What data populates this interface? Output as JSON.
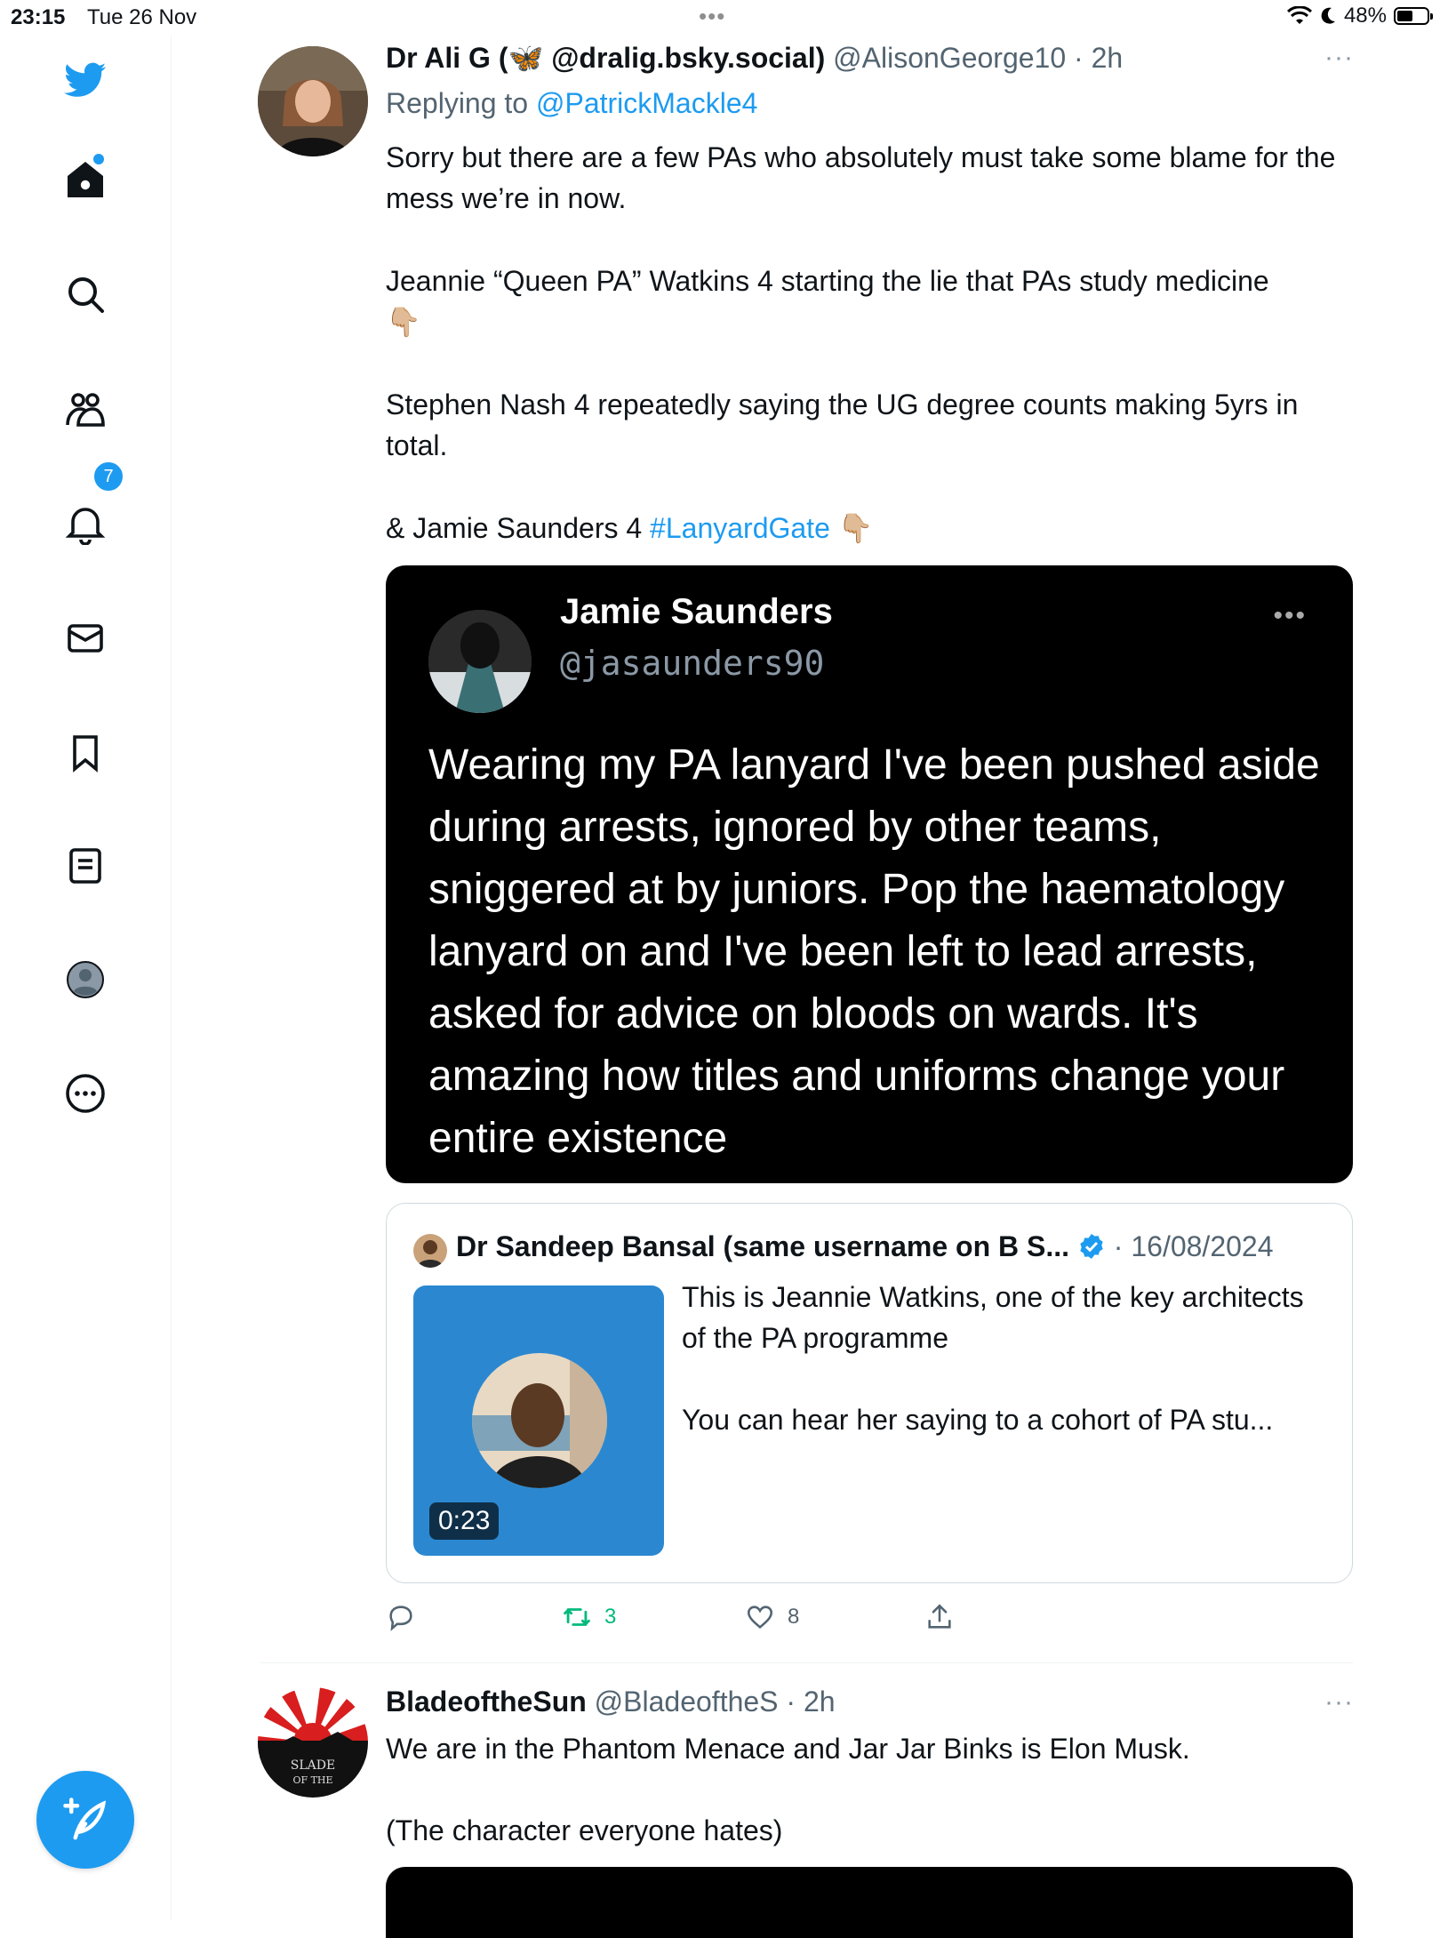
{
  "status_bar": {
    "time": "23:15",
    "date": "Tue 26 Nov",
    "dots": "•••",
    "battery": "48%",
    "battery_level": 0.48
  },
  "sidebar": {
    "items": [
      {
        "name": "twitter-logo-icon"
      },
      {
        "name": "home-icon"
      },
      {
        "name": "search-icon"
      },
      {
        "name": "communities-icon"
      },
      {
        "name": "notifications-icon",
        "badge": "7"
      },
      {
        "name": "messages-icon"
      },
      {
        "name": "bookmarks-icon"
      },
      {
        "name": "lists-icon"
      },
      {
        "name": "profile-icon"
      },
      {
        "name": "more-icon"
      }
    ],
    "compose_icon": "compose-icon"
  },
  "tweet1": {
    "name": "Dr Ali G (🦋 @dralig.bsky.social)",
    "handle": "@AlisonGeorge10",
    "sep": "·",
    "time": "2h",
    "more": "···",
    "replying_prefix": "Replying to",
    "replying_to": "@PatrickMackle4",
    "p1": "Sorry but there are a few PAs who absolutely must take some blame for the mess we’re in now.",
    "p2": "Jeannie “Queen PA” Watkins 4 starting the lie that PAs study medicine",
    "p2_emoji": "👇🏼",
    "p3": "Stephen Nash 4 repeatedly saying the UG degree counts making 5yrs in total.",
    "p4_prefix": "& Jamie Saunders 4",
    "p4_hashtag": "#LanyardGate",
    "p4_emoji": "👇🏼",
    "embedded_image": {
      "name": "Jamie Saunders",
      "handle": "@jasaunders90",
      "more": "•••",
      "text": "Wearing my PA lanyard I've been pushed aside during arrests, ignored by other teams, sniggered at by juniors. Pop the haematology lanyard on and I've been left to lead arrests, asked for advice on bloods on wards. It's amazing how titles and uniforms change your entire existence"
    },
    "quote": {
      "name": "Dr Sandeep Bansal (same username on B S...",
      "sep": "·",
      "date": "16/08/2024",
      "duration": "0:23",
      "text1": "This is Jeannie Watkins, one of the key architects of the PA programme",
      "text2": "You can hear her saying to a cohort of PA stu..."
    },
    "actions": {
      "reply_count": "",
      "retweet_count": "3",
      "like_count": "8"
    }
  },
  "tweet2": {
    "name": "BladeoftheSun",
    "handle": "@BladeoftheS",
    "sep": "·",
    "time": "2h",
    "more": "···",
    "p1": "We are in the Phantom Menace and Jar Jar Binks is Elon Musk.",
    "p2": "(The character everyone hates)"
  },
  "colors": {
    "accent": "#1d9bf0",
    "retweet_green": "#00ba7c",
    "secondary_text": "#536471"
  }
}
